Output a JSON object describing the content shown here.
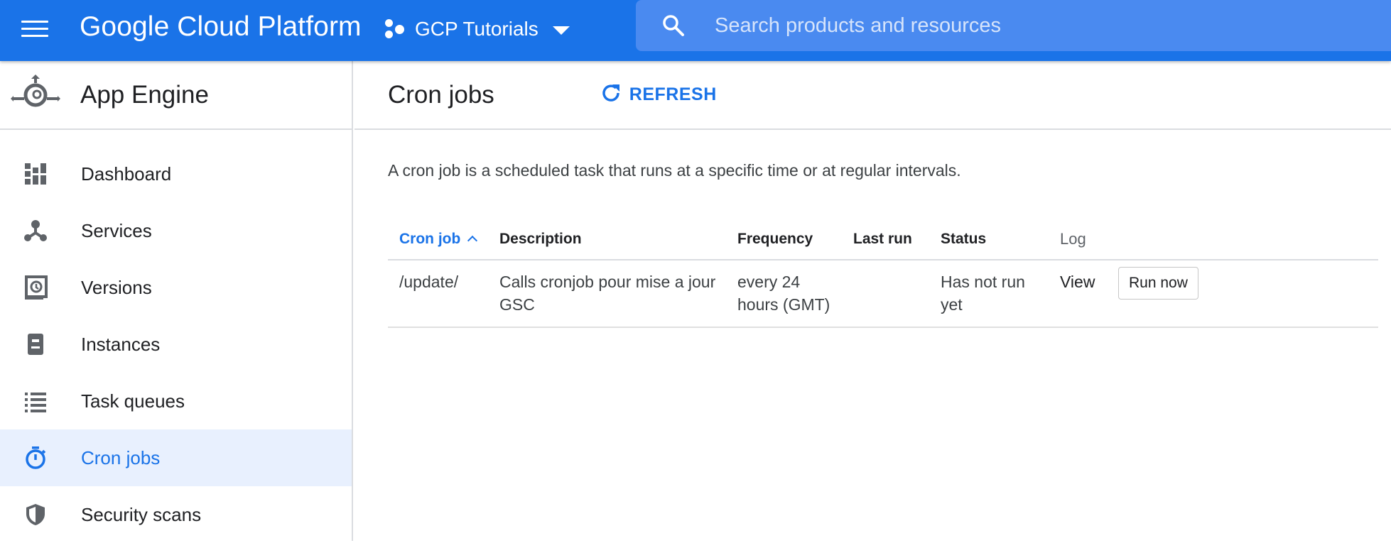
{
  "topbar": {
    "brand": "Google Cloud Platform",
    "project_name": "GCP Tutorials",
    "search_placeholder": "Search products and resources",
    "color": "#1a73e8"
  },
  "sidebar": {
    "product_title": "App Engine",
    "items": [
      {
        "label": "Dashboard",
        "icon": "dashboard-icon"
      },
      {
        "label": "Services",
        "icon": "services-icon"
      },
      {
        "label": "Versions",
        "icon": "versions-icon"
      },
      {
        "label": "Instances",
        "icon": "instances-icon"
      },
      {
        "label": "Task queues",
        "icon": "task-queues-icon"
      },
      {
        "label": "Cron jobs",
        "icon": "cron-jobs-icon",
        "active": true
      },
      {
        "label": "Security scans",
        "icon": "security-scans-icon"
      }
    ]
  },
  "main": {
    "title": "Cron jobs",
    "refresh_label": "REFRESH",
    "intro": "A cron job is a scheduled task that runs at a specific time or at regular intervals.",
    "table": {
      "headers": {
        "cron_job": "Cron job",
        "description": "Description",
        "frequency": "Frequency",
        "last_run": "Last run",
        "status": "Status",
        "log": "Log"
      },
      "rows": [
        {
          "cron_job": "/update/",
          "description": "Calls cronjob pour mise a jour GSC",
          "frequency": "every 24 hours (GMT)",
          "last_run": "",
          "status": "Has not run yet",
          "log": "View",
          "action": "Run now"
        }
      ]
    }
  }
}
